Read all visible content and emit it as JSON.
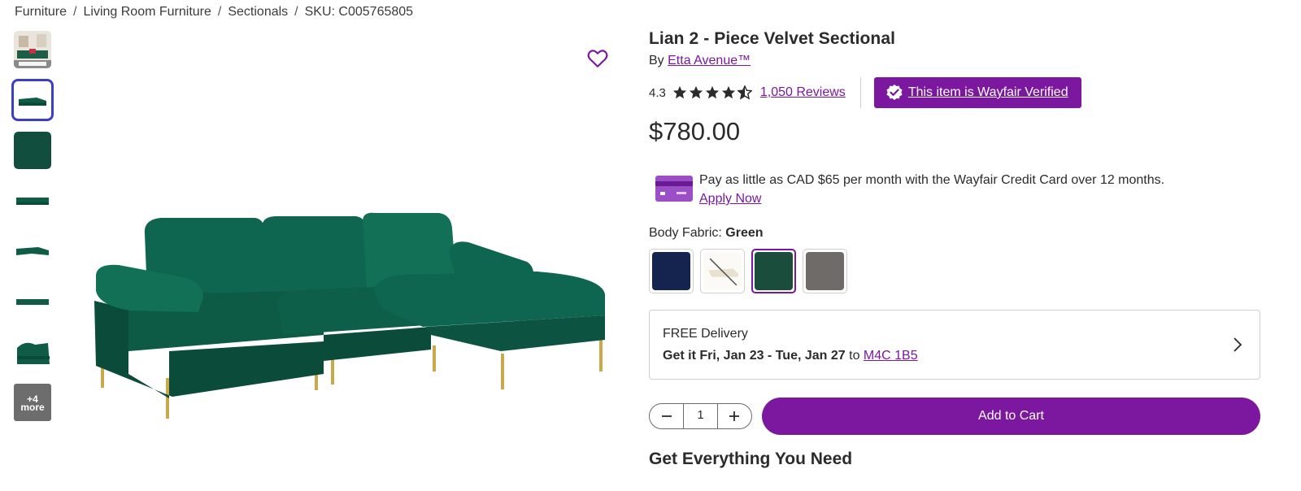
{
  "breadcrumb": {
    "items": [
      "Furniture",
      "Living Room Furniture",
      "Sectionals"
    ],
    "separator": "/",
    "sku": "SKU: C005765805"
  },
  "gallery": {
    "more_count": "+4",
    "more_label": "more"
  },
  "product": {
    "title": "Lian 2 - Piece Velvet Sectional",
    "by_prefix": "By",
    "brand": "Etta Avenue™",
    "rating": "4.3",
    "rating_value": 4.3,
    "reviews": "1,050 Reviews",
    "verified": "This item is Wayfair Verified",
    "price": "$780.00"
  },
  "credit": {
    "text": "Pay as little as CAD $65 per month with the Wayfair Credit Card over 12 months.",
    "link": "Apply Now"
  },
  "fabric": {
    "label": "Body Fabric:",
    "selected": "Green",
    "swatches": [
      {
        "name": "navy",
        "color": "#14244f"
      },
      {
        "name": "unavailable",
        "color": "#f4f1e8"
      },
      {
        "name": "green",
        "color": "#1b4d3c"
      },
      {
        "name": "gray",
        "color": "#6f6b68"
      }
    ]
  },
  "delivery": {
    "line1": "FREE Delivery",
    "dates": "Get it Fri, Jan 23 - Tue, Jan 27",
    "to": "to",
    "postal": "M4C 1B5"
  },
  "cart": {
    "quantity": "1",
    "add_label": "Add to Cart"
  },
  "section": {
    "title": "Get Everything You Need"
  },
  "colors": {
    "brand": "#7b189f",
    "thumb_selected": "#3b3fc4",
    "sofa": "#0d5a45"
  }
}
